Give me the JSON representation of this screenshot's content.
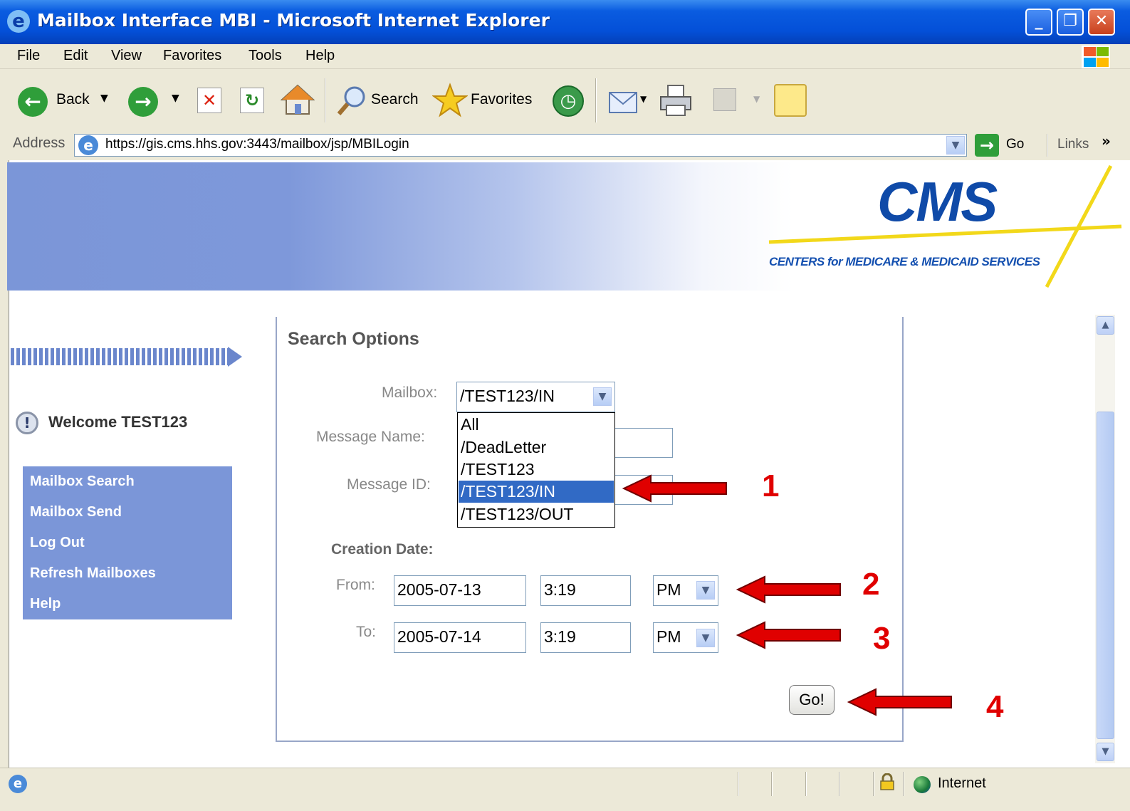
{
  "window": {
    "title": "Mailbox Interface MBI - Microsoft Internet Explorer",
    "minimize_glyph": "_",
    "restore_glyph": "❐",
    "close_glyph": "✕"
  },
  "menu": [
    "File",
    "Edit",
    "View",
    "Favorites",
    "Tools",
    "Help"
  ],
  "toolbar": {
    "back_label": "Back",
    "search_label": "Search",
    "favorites_label": "Favorites"
  },
  "address": {
    "label": "Address",
    "url": "https://gis.cms.hhs.gov:3443/mailbox/jsp/MBILogin",
    "go_label": "Go",
    "links_label": "Links",
    "more_glyph": "»"
  },
  "banner": {
    "logo_text": "CMS",
    "subtitle": "CENTERS for MEDICARE & MEDICAID SERVICES"
  },
  "sidebar": {
    "welcome": "Welcome TEST123",
    "items": [
      "Mailbox Search",
      "Mailbox Send",
      "Log Out",
      "Refresh Mailboxes",
      "Help"
    ]
  },
  "search": {
    "heading": "Search Options",
    "mailbox_label": "Mailbox:",
    "mailbox_value": "/TEST123/IN",
    "mailbox_options": [
      "All",
      "/DeadLetter",
      "/TEST123",
      "/TEST123/IN",
      "/TEST123/OUT"
    ],
    "selected_option_index": 3,
    "message_name_label": "Message Name:",
    "message_id_label": "Message ID:",
    "creation_date_label": "Creation Date:",
    "from_label": "From:",
    "from_date": "2005-07-13",
    "from_time": "3:19",
    "from_ampm": "PM",
    "to_label": "To:",
    "to_date": "2005-07-14",
    "to_time": "3:19",
    "to_ampm": "PM",
    "go_button": "Go!"
  },
  "callouts": [
    "1",
    "2",
    "3",
    "4"
  ],
  "status": {
    "zone": "Internet"
  },
  "colors": {
    "titlebar": "#0450d8",
    "chrome": "#ece9d8",
    "banner_blue": "#7b96d8",
    "nav_bg": "#7b96d8",
    "logo_blue": "#0f4aa8",
    "logo_yellow": "#f2d81a",
    "selection": "#316ac5",
    "callout_red": "#e00000"
  }
}
